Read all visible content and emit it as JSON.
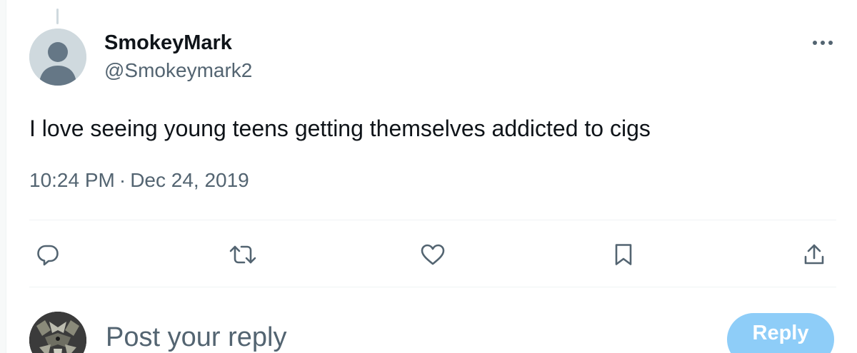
{
  "tweet": {
    "display_name": "SmokeyMark",
    "handle": "@Smokeymark2",
    "text": "I love seeing young teens getting themselves addicted to cigs",
    "time": "10:24 PM",
    "separator": "·",
    "date": "Dec 24, 2019",
    "avatar_icon": "default-avatar-icon",
    "more_icon": "more-dots-icon"
  },
  "actions": [
    {
      "name": "reply",
      "icon": "reply-icon"
    },
    {
      "name": "retweet",
      "icon": "retweet-icon"
    },
    {
      "name": "like",
      "icon": "heart-icon"
    },
    {
      "name": "bookmark",
      "icon": "bookmark-icon"
    },
    {
      "name": "share",
      "icon": "share-icon"
    }
  ],
  "reply_box": {
    "placeholder": "Post your reply",
    "button_label": "Reply"
  },
  "colors": {
    "text_primary": "#0f1419",
    "text_secondary": "#536471",
    "divider": "#eff3f4",
    "reply_button_disabled": "#8ecdf8"
  }
}
